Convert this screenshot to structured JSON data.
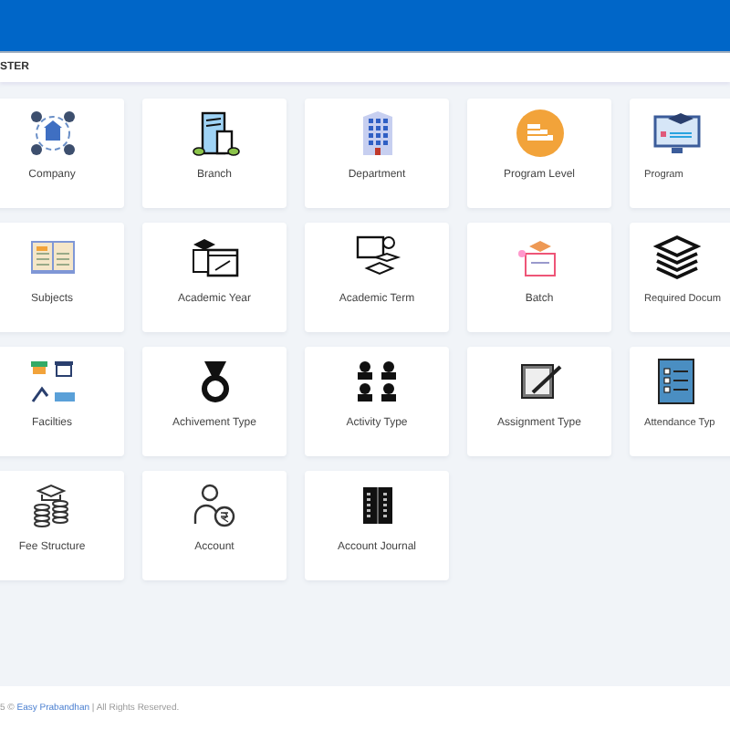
{
  "breadcrumb": "STER",
  "tiles": [
    {
      "label": "Company"
    },
    {
      "label": "Branch"
    },
    {
      "label": "Department"
    },
    {
      "label": "Program Level"
    },
    {
      "label": "Program"
    },
    {
      "label": "Subjects"
    },
    {
      "label": "Academic Year"
    },
    {
      "label": "Academic Term"
    },
    {
      "label": "Batch"
    },
    {
      "label": "Required Docum"
    },
    {
      "label": "Facilties"
    },
    {
      "label": "Achivement Type"
    },
    {
      "label": "Activity Type"
    },
    {
      "label": "Assignment Type"
    },
    {
      "label": "Attendance Typ"
    },
    {
      "label": "Fee Structure"
    },
    {
      "label": "Account"
    },
    {
      "label": "Account Journal"
    }
  ],
  "footer": {
    "before": "5 ©",
    "link": "Easy Prabandhan",
    "after": "| All Rights Reserved."
  }
}
